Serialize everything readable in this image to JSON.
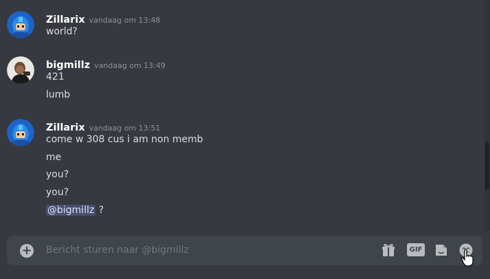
{
  "messages": [
    {
      "author": "Zillarix",
      "timestamp": "vandaag om 13:48",
      "lines": [
        "world?"
      ]
    },
    {
      "author": "bigmillz",
      "timestamp": "vandaag om 13:49",
      "lines": [
        "421",
        "lumb"
      ]
    },
    {
      "author": "Zillarix",
      "timestamp": "vandaag om 13:51",
      "lines": [
        "come w 308 cus i am non memb",
        "me",
        "you?",
        "you?"
      ],
      "mention": "@bigmillz",
      "mention_tail": " ?"
    }
  ],
  "composer": {
    "placeholder": "Bericht sturen naar @bigmillz",
    "icons": [
      "add-attachment-icon",
      "gift-icon",
      "gif-icon",
      "sticker-icon",
      "emoji-icon"
    ],
    "gif_label": "GIF"
  },
  "colors": {
    "background": "#36393f",
    "composer": "#40444b",
    "mention_bg": "#4e5b8f"
  }
}
